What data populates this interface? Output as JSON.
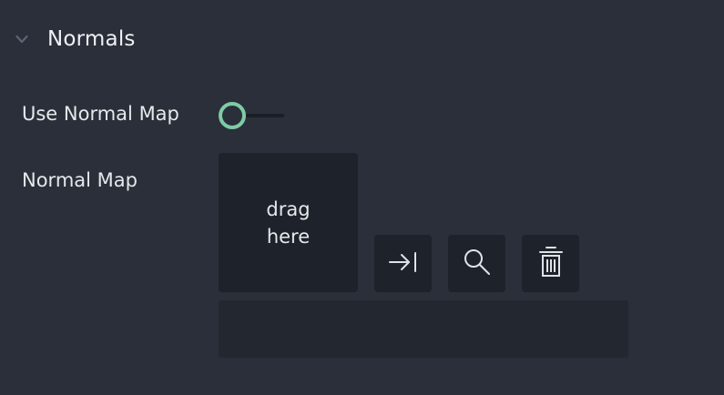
{
  "section": {
    "title": "Normals",
    "expanded": true
  },
  "use_normal_map": {
    "label": "Use Normal Map",
    "value": false
  },
  "normal_map": {
    "label": "Normal Map",
    "drop_line1": "drag",
    "drop_line2": "here",
    "path": ""
  },
  "buttons": {
    "assign": "arrow-to-right-icon",
    "browse": "search-icon",
    "clear": "trash-icon"
  },
  "colors": {
    "accent": "#7ecba6",
    "background": "#2a2f3a",
    "field": "#1e222a"
  }
}
